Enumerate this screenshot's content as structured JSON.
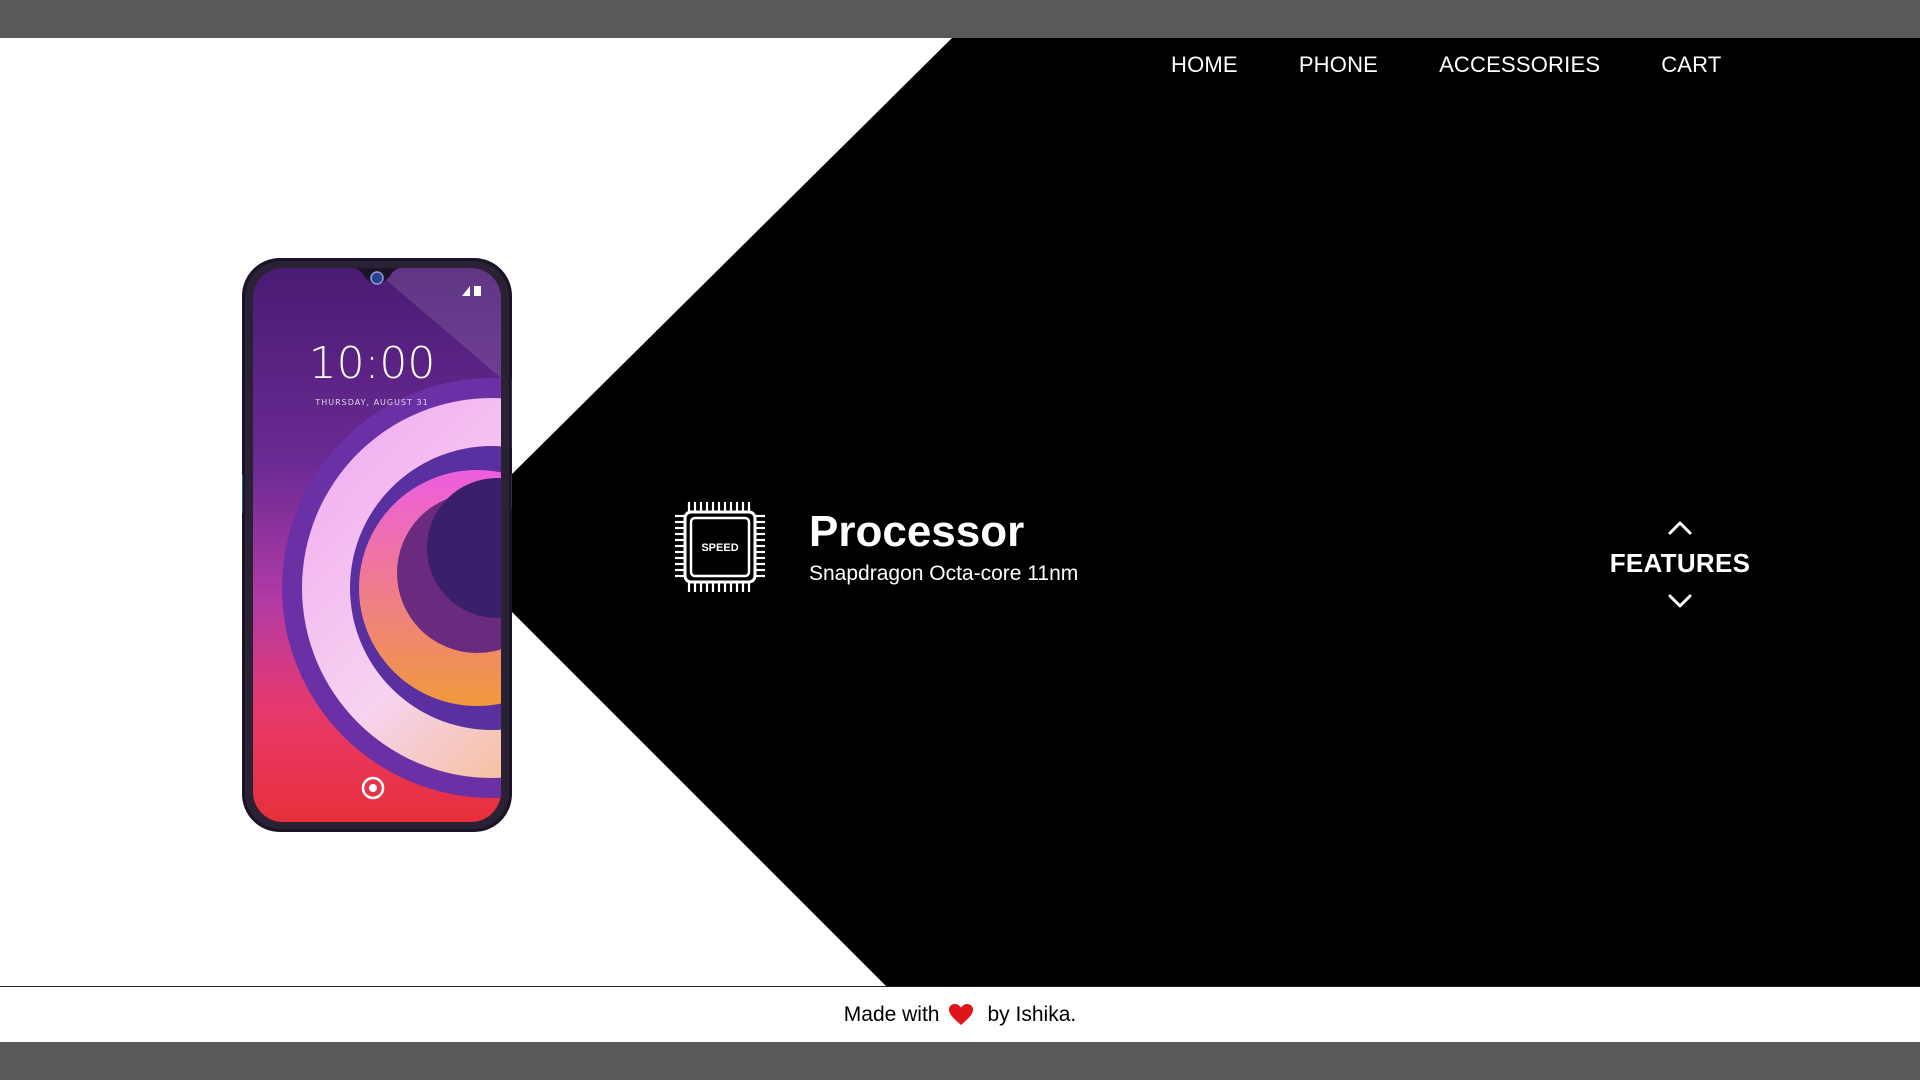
{
  "nav": {
    "items": [
      {
        "label": "HOME"
      },
      {
        "label": "PHONE"
      },
      {
        "label": "ACCESSORIES"
      },
      {
        "label": "CART"
      }
    ]
  },
  "phone": {
    "time": "10:00",
    "date": "THURSDAY, AUGUST 31"
  },
  "feature": {
    "chip_label": "SPEED",
    "title": "Processor",
    "subtitle": "Snapdragon Octa-core 11nm"
  },
  "features_nav": {
    "label": "FEATURES"
  },
  "footer": {
    "prefix": "Made with",
    "suffix": "by Ishika."
  },
  "colors": {
    "frame": "#595959",
    "panel": "#000000",
    "background": "#ffffff",
    "heart": "#e0151c"
  }
}
